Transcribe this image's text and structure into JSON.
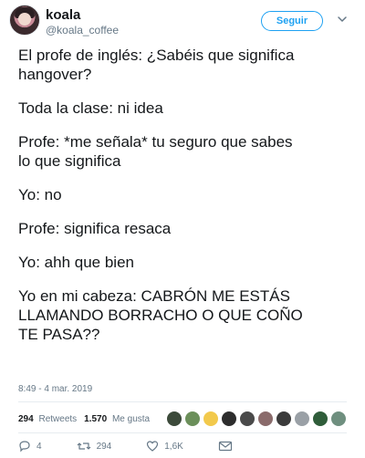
{
  "user": {
    "display_name": "koala",
    "handle": "@koala_coffee",
    "follow_label": "Seguir"
  },
  "tweet": {
    "lines": [
      "El profe de inglés: ¿Sabéis que significa\nhangover?",
      "Toda la clase: ni idea",
      "Profe: *me señala* tu seguro que sabes\nlo que significa",
      "Yo: no",
      "Profe: significa resaca",
      "Yo: ahh que bien",
      "Yo en mi cabeza: CABRÓN ME ESTÁS\nLLAMANDO BORRACHO O QUE COÑO\nTE PASA??"
    ],
    "timestamp": "8:49 - 4 mar. 2019"
  },
  "stats": {
    "retweets_count": "294",
    "retweets_label": "Retweets",
    "likes_count": "1.570",
    "likes_label": "Me gusta",
    "liker_colors": [
      "#3c4a3a",
      "#6b8f5a",
      "#f2c94c",
      "#2d2d2d",
      "#4a4a4a",
      "#8a6b6b",
      "#3b3b3b",
      "#9aa0a6",
      "#2f5d3a",
      "#6f8f7f"
    ]
  },
  "actions": {
    "reply_count": "4",
    "retweet_count": "294",
    "like_count": "1,6K",
    "icons": [
      "reply-icon",
      "retweet-icon",
      "like-icon",
      "message-icon"
    ]
  },
  "colors": {
    "accent": "#1da1f2",
    "text": "#14171a",
    "secondary": "#657786"
  }
}
